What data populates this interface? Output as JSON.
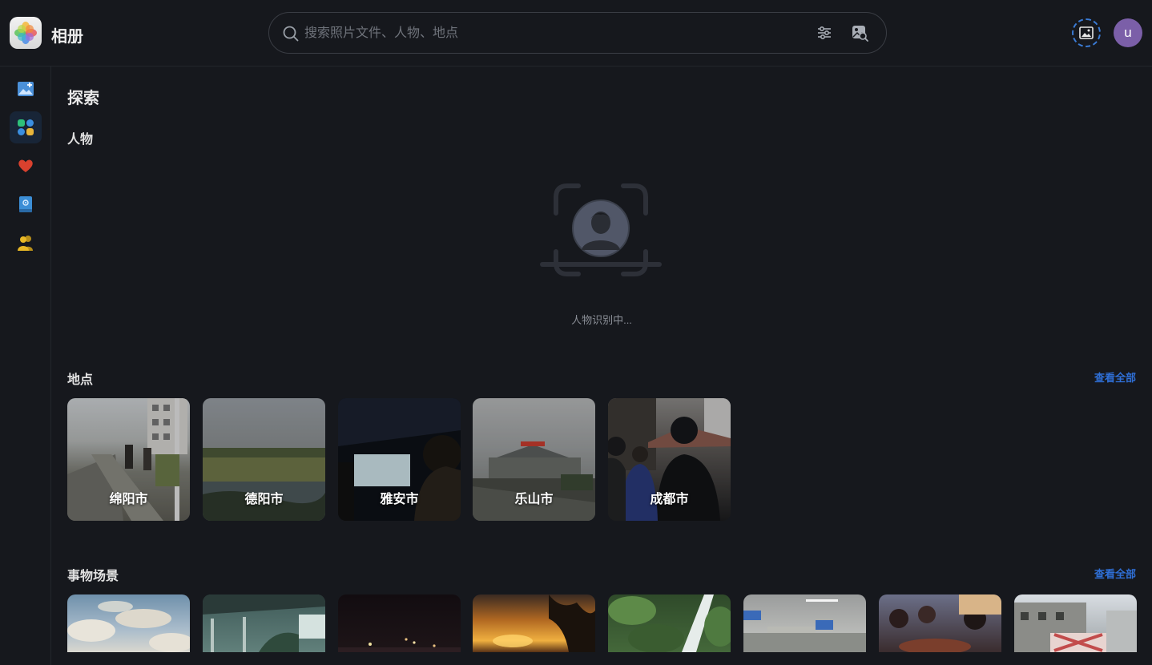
{
  "app": {
    "title": "相册"
  },
  "search": {
    "placeholder": "搜索照片文件、人物、地点"
  },
  "user": {
    "avatar_letter": "u"
  },
  "sidebar": {
    "items": [
      {
        "name": "photos",
        "icon": "photos-icon"
      },
      {
        "name": "explore",
        "icon": "explore-grid-icon",
        "active": true
      },
      {
        "name": "favorites",
        "icon": "heart-icon"
      },
      {
        "name": "albums",
        "icon": "album-icon"
      },
      {
        "name": "shared",
        "icon": "people-icon"
      }
    ]
  },
  "main": {
    "title": "探索",
    "people": {
      "title": "人物",
      "status": "人物识别中..."
    },
    "places": {
      "title": "地点",
      "view_all": "查看全部",
      "items": [
        {
          "label": "绵阳市"
        },
        {
          "label": "德阳市"
        },
        {
          "label": "雅安市"
        },
        {
          "label": "乐山市"
        },
        {
          "label": "成都市"
        }
      ]
    },
    "scenes": {
      "title": "事物场景",
      "view_all": "查看全部",
      "count": 8
    }
  },
  "colors": {
    "accent": "#2f6fd6",
    "background": "#16181d",
    "avatar": "#7b5fa8"
  }
}
